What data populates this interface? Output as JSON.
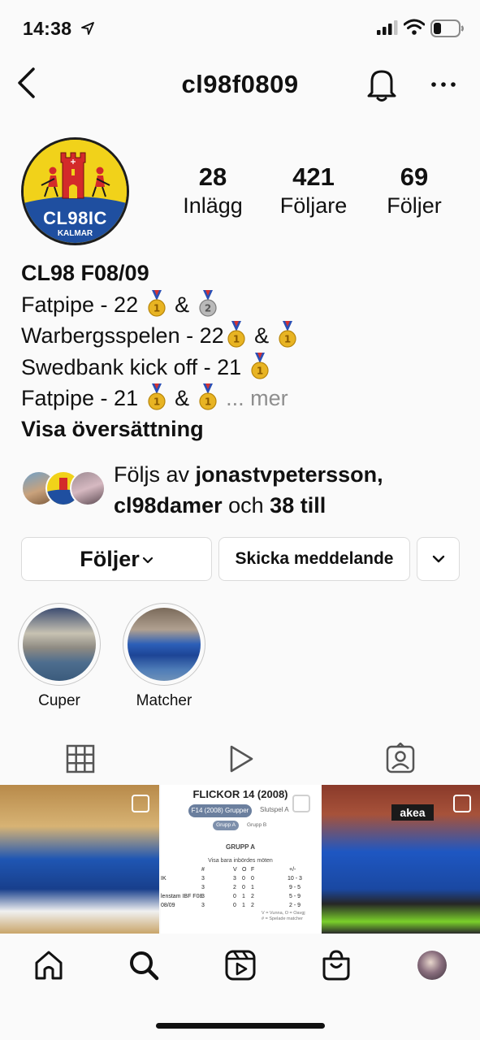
{
  "status_bar": {
    "time": "14:38"
  },
  "header": {
    "username": "cl98f0809"
  },
  "profile": {
    "logo_text": "CL98IC",
    "logo_subtext": "KALMAR",
    "stats": [
      {
        "value": "28",
        "label": "Inlägg"
      },
      {
        "value": "421",
        "label": "Följare"
      },
      {
        "value": "69",
        "label": "Följer"
      }
    ],
    "display_name": "CL98 F08/09",
    "bio_lines": [
      {
        "text": "Fatpipe - 22",
        "amp": "&"
      },
      {
        "text": "Warbergsspelen - 22",
        "amp": "&"
      },
      {
        "text": "Swedbank kick off - 21"
      },
      {
        "text": "Fatpipe - 21",
        "amp": "&",
        "truncation": "... mer"
      }
    ],
    "translate_label": "Visa översättning",
    "followed_by": {
      "prefix": "Följs av",
      "user1": "jonastvpetersson,",
      "user2": "cl98damer",
      "conj": "och",
      "count": "38 till"
    }
  },
  "actions": {
    "follow_label": "Följer",
    "message_label": "Skicka meddelande"
  },
  "highlights": [
    {
      "label": "Cuper"
    },
    {
      "label": "Matcher"
    }
  ],
  "grid": {
    "doc_title": "FLICKOR 14 (2008)",
    "doc_tab_active": "F14 (2008) Grupper",
    "doc_tab_other": "Slutspel A",
    "doc_sub_active": "Grupp A",
    "doc_sub_other": "Grupp B",
    "doc_group_title": "GRUPP A",
    "doc_toggle": "Visa bara inbördes möten",
    "doc_head": {
      "games": "#",
      "v": "V",
      "o": "O",
      "f": "F",
      "gd": "+/-"
    },
    "doc_rows": [
      {
        "team": "IK",
        "games": "3",
        "v": "3",
        "o": "0",
        "f": "0",
        "gd": "10 - 3"
      },
      {
        "team": "",
        "games": "3",
        "v": "2",
        "o": "0",
        "f": "1",
        "gd": "9 - 5"
      },
      {
        "team": "lenstam IBF F08",
        "games": "3",
        "v": "0",
        "o": "1",
        "f": "2",
        "gd": "5 - 9"
      },
      {
        "team": "08/09",
        "games": "3",
        "v": "0",
        "o": "1",
        "f": "2",
        "gd": "2 - 9"
      }
    ],
    "doc_foot1": "V = Vunna, O = Oavgj",
    "doc_foot2": "# = Spelade matcher",
    "banner_text": "akea"
  },
  "colors": {
    "gold": "#e8b423",
    "silver": "#a9a9a9",
    "logo_blue": "#1f4fa0",
    "logo_red": "#d32a2a",
    "logo_yellow": "#f1d21a"
  }
}
